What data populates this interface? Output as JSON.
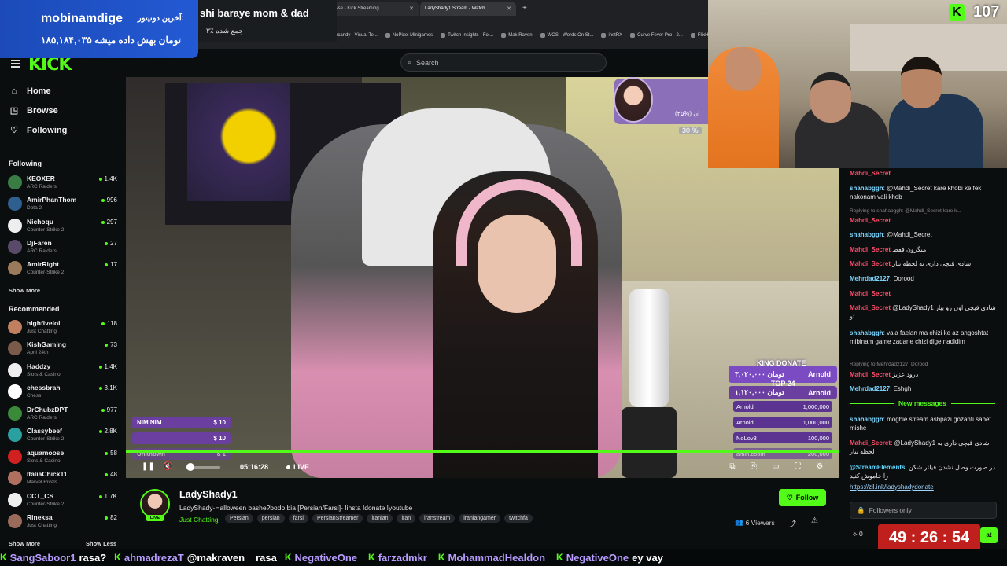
{
  "browser": {
    "tabs": [
      {
        "label": "Browse - Kick Streaming",
        "active": false
      },
      {
        "label": "LadyShady1 Stream - Watch",
        "active": true
      }
    ],
    "bookmarks": [
      "Eyecandy - Visual Te...",
      "NoPixel Minigames",
      "Twitch Insights - Fol...",
      "Mak Raven",
      "WOS - Words On St...",
      "instRX",
      "Curve Fever Pro - 2...",
      "FlixHQ"
    ]
  },
  "overlay": {
    "donor_label": "mobinamdige",
    "donor_prefix": "آخرین دونیتور:",
    "donor_amount": "۱۸۵,۱۸۴,۰۳۵ تومان بهش داده میشه",
    "goal_title": "shi baraye mom & dad",
    "goal_pct": "۳٪ جمع شده",
    "goal_widget_pct": "(۲۵%) ان",
    "goal_widget_per": "30 %",
    "kick_count": "107"
  },
  "header": {
    "logo": "KICK",
    "search_placeholder": "Search"
  },
  "sidebar": {
    "nav": [
      {
        "label": "Home",
        "icon": "home-icon"
      },
      {
        "label": "Browse",
        "icon": "compass-icon"
      },
      {
        "label": "Following",
        "icon": "heart-icon"
      }
    ],
    "following_title": "Following",
    "following": [
      {
        "name": "KEOXER",
        "category": "ARC Raiders",
        "viewers": "1.4K",
        "color": "#3a7d44"
      },
      {
        "name": "AmirPhanThom",
        "category": "Dota 2",
        "viewers": "996",
        "color": "#2f5f8f"
      },
      {
        "name": "Nichoqu",
        "category": "Counter-Strike 2",
        "viewers": "297",
        "color": "#eeeeee"
      },
      {
        "name": "DjFaren",
        "category": "ARC Raiders",
        "viewers": "27",
        "color": "#5a4a6a"
      },
      {
        "name": "AmirRight",
        "category": "Counter-Strike 2",
        "viewers": "17",
        "color": "#9a7a5a"
      }
    ],
    "show_more": "Show More",
    "recommended_title": "Recommended",
    "recommended": [
      {
        "name": "highfivelol",
        "category": "Just Chatting",
        "viewers": "118",
        "color": "#c08060"
      },
      {
        "name": "KishGaming",
        "category": "April 24th",
        "viewers": "73",
        "color": "#7a5a4a"
      },
      {
        "name": "Haddzy",
        "category": "Slots & Casino",
        "viewers": "1.4K",
        "color": "#eeeeee"
      },
      {
        "name": "chessbrah",
        "category": "Chess",
        "viewers": "3.1K",
        "color": "#ffffff"
      },
      {
        "name": "DrChubzDPT",
        "category": "ARC Raiders",
        "viewers": "977",
        "color": "#3a8a3a"
      },
      {
        "name": "Classybeef",
        "category": "Counter-Strike 2",
        "viewers": "2.8K",
        "color": "#2aa0a0"
      },
      {
        "name": "aquamoose",
        "category": "Slots & Casino",
        "viewers": "58",
        "color": "#d02020"
      },
      {
        "name": "ItaliaChick11",
        "category": "Marvel Rivals",
        "viewers": "48",
        "color": "#b07060"
      },
      {
        "name": "CCT_CS",
        "category": "Counter-Strike 2",
        "viewers": "1.7K",
        "color": "#eeeeee"
      },
      {
        "name": "Rineksa",
        "category": "Just Chatting",
        "viewers": "82",
        "color": "#9a6a5a"
      }
    ],
    "show_more_bottom": "Show More",
    "show_less": "Show Less"
  },
  "video": {
    "tips": [
      {
        "name": "NIM NIM",
        "amount": "$ 10"
      },
      {
        "name": "",
        "amount": "$ 10"
      },
      {
        "name": "Unknown",
        "amount": "$ 1"
      }
    ],
    "king_title": "KING DONATE",
    "king_amount": "۳,۰۲۰,۰۰۰ تومان",
    "king_name": "Arnold",
    "top_title": "TOP 24",
    "top_amount": "۱,۱۲۰,۰۰۰ تومان",
    "top_name": "Arnold",
    "ranks": [
      {
        "name": "Arnold",
        "amount": "1,000,000"
      },
      {
        "name": "Arnold",
        "amount": "1,000,000"
      },
      {
        "name": "NoLov3",
        "amount": "100,000"
      },
      {
        "name": "amin.coom",
        "amount": "200,000"
      }
    ],
    "time": "05:16:28",
    "live_label": "LIVE"
  },
  "stream": {
    "name": "LadyShady1",
    "title": "LadyShady-Halloween bashe?bodo bia [Persian/Farsi]- !insta !donate !youtube",
    "category": "Just Chatting",
    "tags": [
      "Persian",
      "persian",
      "farsi",
      "PersianStreamer",
      "iranian",
      "iran",
      "iranstream",
      "iraniangamer",
      "twitchfa"
    ],
    "follow_label": "Follow",
    "viewers": "6 Viewers",
    "live_tag": "LIVE"
  },
  "chat": {
    "messages": [
      {
        "user": "Mahdi_Secret",
        "text": "",
        "red": true
      },
      {
        "user": "shahabggh",
        "text": "@Mahdi_Secret kare khobi ke fek nakonam vali khob",
        "red": false
      },
      {
        "reply": "Replying to shahabggh: @Mahdi_Secret kare k..."
      },
      {
        "user": "Mahdi_Secret",
        "text": "",
        "red": true
      },
      {
        "user": "shahabggh",
        "text": "@Mahdi_Secret",
        "red": false
      },
      {
        "user": "Mahdi_Secret",
        "text": "میگرون فقط",
        "red": true
      },
      {
        "user": "Mahdi_Secret",
        "text": "شادی قیچی داری به لحظه بیار",
        "red": true
      },
      {
        "user": "Mehrdad2127",
        "text": "Dorood",
        "red": false
      },
      {
        "user": "Mahdi_Secret",
        "text": "",
        "red": true
      },
      {
        "user": "Mahdi_Secret",
        "text": "@LadyShady1 شادی قیچی اون رو بیار تو",
        "red": true
      },
      {
        "user": "shahabggh",
        "text": "vala faelan ma chizi ke az angoshtat mibinam game zadane chizi dige nadidim",
        "red": false
      },
      {
        "reply": "Replying to Mehrdad2127: Dorood"
      },
      {
        "user": "Mahdi_Secret",
        "text": "درود عزیز",
        "red": true
      },
      {
        "user": "Mehrdad2127",
        "text": "Eshgh",
        "red": false
      }
    ],
    "new_messages": "New messages",
    "after": [
      {
        "user": "shahabggh",
        "text": "moghie stream ashpazi gozahti sabet mishe",
        "red": false
      },
      {
        "user": "Mahdi_Secret",
        "text": "@LadyShady1 شادی قیچی داری به لحظه بیار",
        "red": true
      },
      {
        "user": "@StreamElements",
        "text": "در صورت وصل نشدن فیلتر شکن را خاموش کنید",
        "red": false
      }
    ],
    "link": "https://zil.ink/ladyshadydonate",
    "input_placeholder": "Followers only",
    "count": "0",
    "send_label": "at",
    "timer": "49 : 26 : 54"
  },
  "ticker": [
    {
      "name": "SangSaboor1",
      "text": "rasa?"
    },
    {
      "name": "ahmadrezaT",
      "text": "@makraven"
    },
    {
      "name": "",
      "text": "rasa"
    },
    {
      "name": "NegativeOne",
      "text": ""
    },
    {
      "name": "farzadmkr",
      "text": ""
    },
    {
      "name": "MohammadHealdon",
      "text": ""
    },
    {
      "name": "NegativeOne",
      "text": "ey vay"
    }
  ]
}
